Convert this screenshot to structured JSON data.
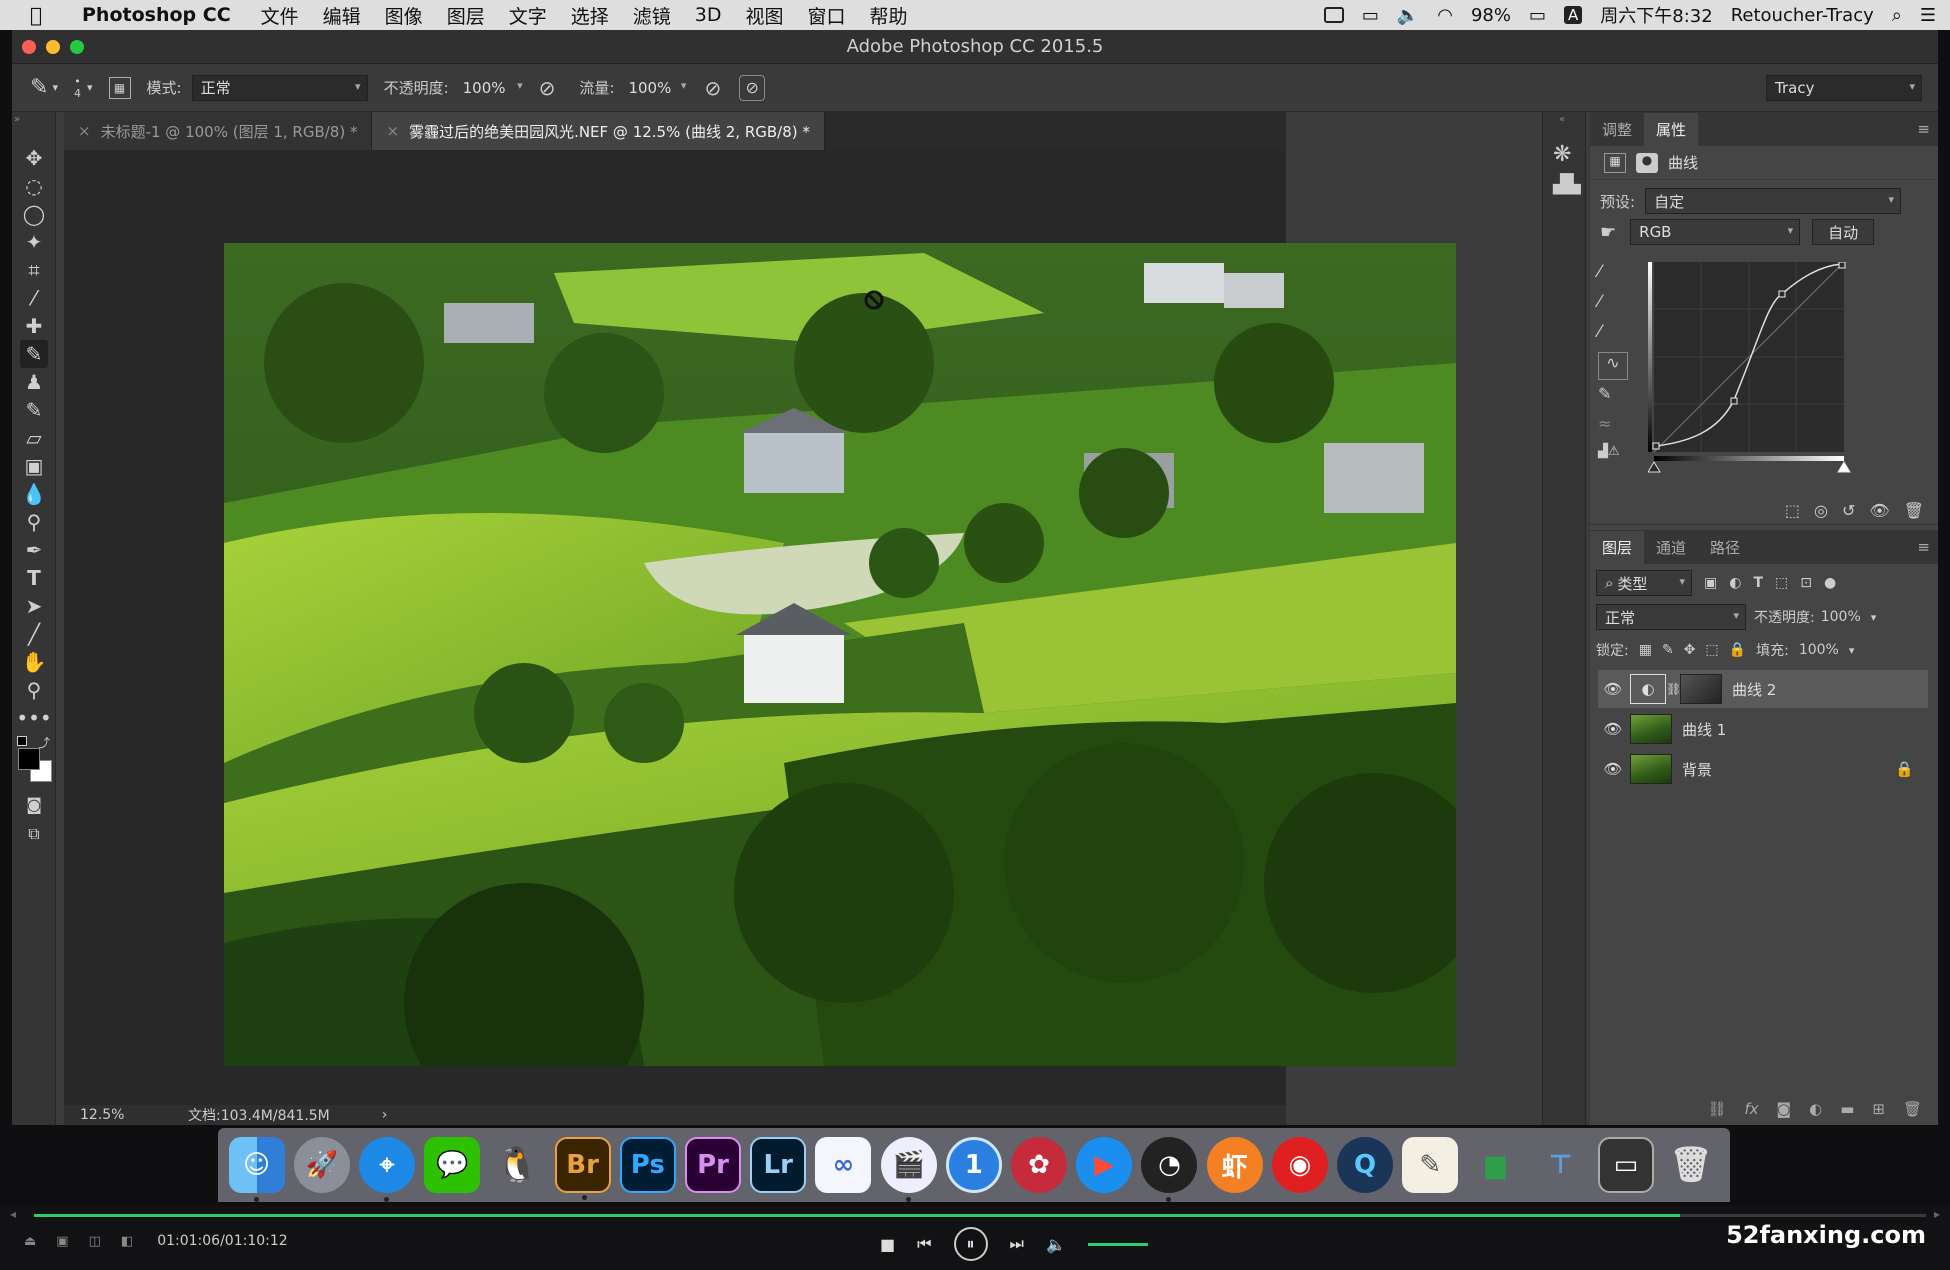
{
  "menubar": {
    "app": "Photoshop CC",
    "items": [
      "文件",
      "编辑",
      "图像",
      "图层",
      "文字",
      "选择",
      "滤镜",
      "3D",
      "视图",
      "窗口",
      "帮助"
    ],
    "battery": "98%",
    "input_indicator": "A",
    "clock": "周六下午8:32",
    "user": "Retoucher-Tracy"
  },
  "window": {
    "title": "Adobe Photoshop CC 2015.5"
  },
  "options": {
    "brush_size": "4",
    "mode_label": "模式:",
    "mode_value": "正常",
    "opacity_label": "不透明度:",
    "opacity_value": "100%",
    "flow_label": "流量:",
    "flow_value": "100%",
    "workspace": "Tracy"
  },
  "tabs": [
    {
      "label": "未标题-1 @ 100% (图层 1, RGB/8) *"
    },
    {
      "label": "雾霾过后的绝美田园风光.NEF @ 12.5% (曲线 2, RGB/8) *"
    }
  ],
  "status": {
    "zoom": "12.5%",
    "doc": "文档:103.4M/841.5M"
  },
  "properties": {
    "tab_adjust": "调整",
    "tab_props": "属性",
    "type_label": "曲线",
    "preset_label": "预设:",
    "preset_value": "自定",
    "channel": "RGB",
    "auto": "自动"
  },
  "layers": {
    "tab_layers": "图层",
    "tab_channels": "通道",
    "tab_paths": "路径",
    "filter": "类型",
    "blend": "正常",
    "opacity_label": "不透明度:",
    "opacity_value": "100%",
    "lock_label": "锁定:",
    "fill_label": "填充:",
    "fill_value": "100%",
    "items": [
      {
        "name": "曲线 2"
      },
      {
        "name": "曲线 1"
      },
      {
        "name": "背景"
      }
    ]
  },
  "dock_apps": [
    "Finder",
    "Launchpad",
    "Safari",
    "WeChat",
    "QQ",
    "Br",
    "Ps",
    "Pr",
    "Lr",
    "Flow",
    "Keynote",
    "1Password",
    "DaVinci",
    "Infuse",
    "OBS",
    "Xiami",
    "NetEase",
    "QuickTime",
    "TextEdit",
    "Numbers",
    "Keynote2",
    "Screen",
    "Trash"
  ],
  "video": {
    "time": "01:01:06/01:10:12",
    "progress": 0.87,
    "watermark": "52fanxing.com"
  },
  "colors": {
    "accent": "#2ecc71",
    "panel": "#454545"
  }
}
